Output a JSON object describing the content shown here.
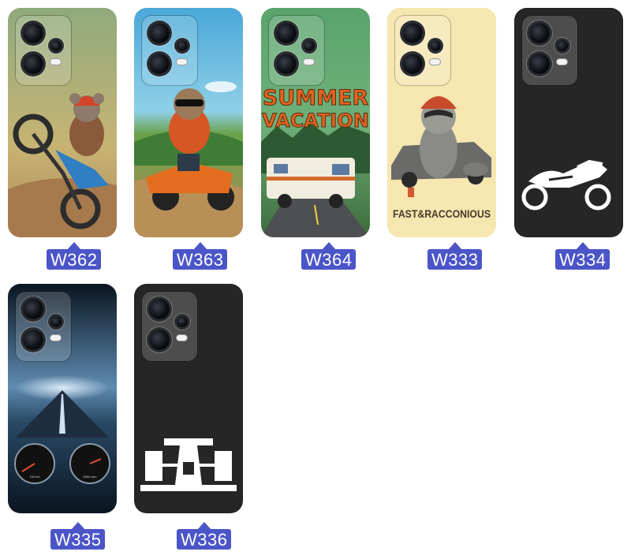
{
  "products": [
    {
      "code": "W362",
      "design": "koala-dirt-bike"
    },
    {
      "code": "W363",
      "design": "sloth-atv"
    },
    {
      "code": "W364",
      "design": "summer-vacation-rv",
      "text_line1": "SUMMER",
      "text_line2": "VACATION"
    },
    {
      "code": "W333",
      "design": "fast-racconious",
      "text": "FAST&RACCONIOUS"
    },
    {
      "code": "W334",
      "design": "sport-motorcycle-outline"
    },
    {
      "code": "W335",
      "design": "highway-speedometer",
      "gauge_left": "100 km",
      "gauge_right": "6500 rpm"
    },
    {
      "code": "W336",
      "design": "formula-car-outline"
    }
  ],
  "colors": {
    "tag_bg": "#4b55c8",
    "tag_text": "#ffffff",
    "black_case": "#262626"
  }
}
